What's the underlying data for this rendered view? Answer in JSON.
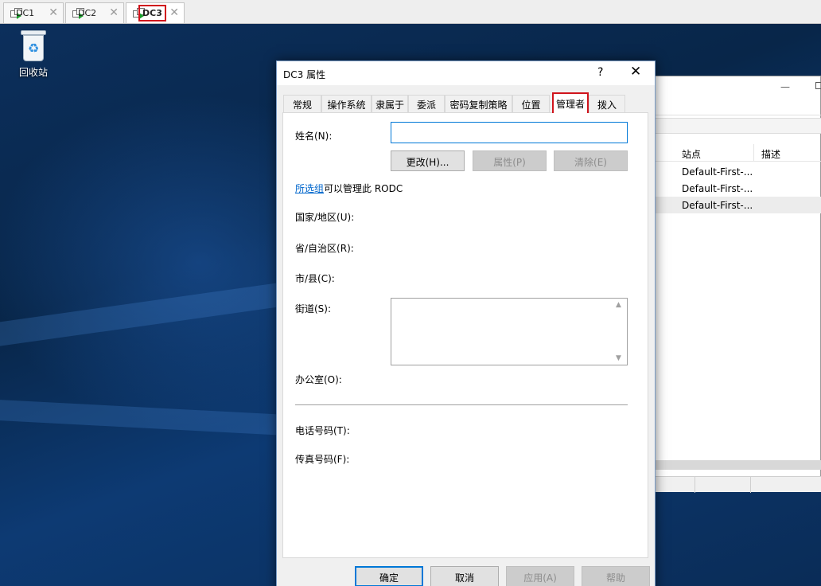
{
  "vm_tabs": [
    {
      "label": "DC1",
      "close": "✕"
    },
    {
      "label": "DC2",
      "close": "✕"
    },
    {
      "label": "DC3",
      "close": "✕"
    }
  ],
  "desktop": {
    "recycle_bin_label": "回收站"
  },
  "background_window": {
    "columns": [
      "站点",
      "描述"
    ],
    "rows": [
      "Default-First-...",
      "Default-First-...",
      "Default-First-..."
    ]
  },
  "dialog": {
    "title": "DC3 属性",
    "help_glyph": "?",
    "close_glyph": "✕",
    "tabs": [
      "常规",
      "操作系统",
      "隶属于",
      "委派",
      "密码复制策略",
      "位置",
      "管理者",
      "拨入"
    ],
    "active_tab": "管理者",
    "name_label": "姓名(N):",
    "name_value": "",
    "change_button": "更改(H)...",
    "properties_button": "属性(P)",
    "clear_button": "清除(E)",
    "manage_link": "所选组",
    "manage_text": "可以管理此 RODC",
    "country_label": "国家/地区(U):",
    "province_label": "省/自治区(R):",
    "city_label": "市/县(C):",
    "street_label": "街道(S):",
    "street_value": "",
    "office_label": "办公室(O):",
    "phone_label": "电话号码(T):",
    "fax_label": "传真号码(F):",
    "ok_button": "确定",
    "cancel_button": "取消",
    "apply_button": "应用(A)",
    "help_button": "帮助"
  }
}
